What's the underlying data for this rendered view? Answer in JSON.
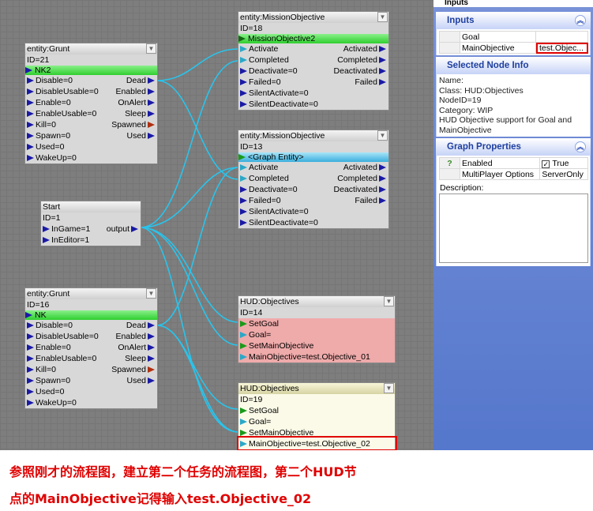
{
  "nodes": {
    "grunt21": {
      "title": "entity:Grunt",
      "id": "ID=21",
      "entity": "NK2",
      "inputs": [
        "Disable=0",
        "DisableUsable=0",
        "Enable=0",
        "EnableUsable=0",
        "Kill=0",
        "Spawn=0",
        "Used=0",
        "WakeUp=0"
      ],
      "outputs": [
        "Dead",
        "Enabled",
        "OnAlert",
        "Sleep",
        "Spawned",
        "Used"
      ]
    },
    "mission18": {
      "title": "entity:MissionObjective",
      "id": "ID=18",
      "entity": "MissionObjective2",
      "inputs": [
        "Activate",
        "Completed",
        "Deactivate=0",
        "Failed=0",
        "SilentActivate=0",
        "SilentDeactivate=0"
      ],
      "outputs": [
        "Activated",
        "Completed",
        "Deactivated",
        "Failed"
      ]
    },
    "mission13": {
      "title": "entity:MissionObjective",
      "id": "ID=13",
      "entity": "<Graph Entity>",
      "inputs": [
        "Activate",
        "Completed",
        "Deactivate=0",
        "Failed=0",
        "SilentActivate=0",
        "SilentDeactivate=0"
      ],
      "outputs": [
        "Activated",
        "Completed",
        "Deactivated",
        "Failed"
      ]
    },
    "start1": {
      "title": "Start",
      "id": "ID=1",
      "inputs": [
        "InGame=1",
        "InEditor=1"
      ],
      "outputs": [
        "output"
      ]
    },
    "grunt16": {
      "title": "entity:Grunt",
      "id": "ID=16",
      "entity": "NK",
      "inputs": [
        "Disable=0",
        "DisableUsable=0",
        "Enable=0",
        "EnableUsable=0",
        "Kill=0",
        "Spawn=0",
        "Used=0",
        "WakeUp=0"
      ],
      "outputs": [
        "Dead",
        "Enabled",
        "OnAlert",
        "Sleep",
        "Spawned",
        "Used"
      ]
    },
    "hud14": {
      "title": "HUD:Objectives",
      "id": "ID=14",
      "inputs": [
        "SetGoal",
        "Goal=",
        "SetMainObjective",
        "MainObjective=test.Objective_01"
      ]
    },
    "hud19": {
      "title": "HUD:Objectives",
      "id": "ID=19",
      "inputs": [
        "SetGoal",
        "Goal=",
        "SetMainObjective",
        "MainObjective=test.Objective_02"
      ]
    }
  },
  "panel": {
    "top_title": "Inputs",
    "inputs_header": "Inputs",
    "inputs_rows": [
      {
        "name": "Goal",
        "value": ""
      },
      {
        "name": "MainObjective",
        "value": "test.Objec..."
      }
    ],
    "selected_header": "Selected Node Info",
    "selected_lines": [
      "Name:",
      "Class: HUD:Objectives",
      "NodeID=19",
      "Category: WIP",
      "HUD Objective support for Goal and MainObjective"
    ],
    "graph_header": "Graph Properties",
    "graph_rows": [
      {
        "gut": "?",
        "name": "Enabled",
        "value": "True",
        "checked": true
      },
      {
        "gut": "",
        "name": "MultiPlayer Options",
        "value": "ServerOnly"
      }
    ],
    "description_label": "Description:"
  },
  "caption": {
    "line1": "参照刚才的流程图，建立第二个任务的流程图，第二个HUD节",
    "line2": "点的MainObjective记得输入test.Objective_02"
  },
  "colors": {
    "highlight": "#e00000",
    "link": "#29c4ec",
    "entity_green": "#2fcf2f",
    "entity_blue": "#3aaedc"
  }
}
